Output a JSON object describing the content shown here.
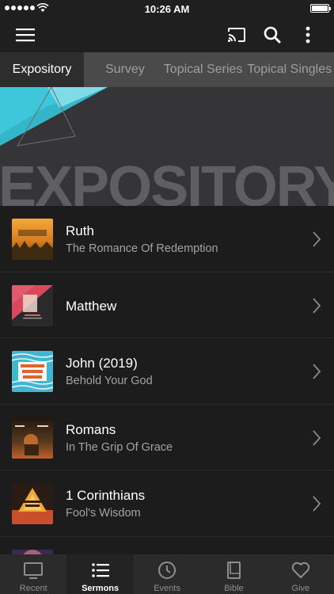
{
  "status_bar": {
    "time": "10:26 AM"
  },
  "app_bar": {
    "icons": [
      "hamburger-menu-icon",
      "cast-icon",
      "search-icon",
      "more-vertical-icon"
    ]
  },
  "tabs": [
    {
      "label": "Expository",
      "active": true
    },
    {
      "label": "Survey",
      "active": false
    },
    {
      "label": "Topical Series",
      "active": false
    },
    {
      "label": "Topical Singles",
      "active": false
    }
  ],
  "banner": {
    "title": "EXPOSITORY",
    "accent_color": "#3cc6d8"
  },
  "sermons": [
    {
      "title": "Ruth",
      "subtitle": "The Romance Of Redemption"
    },
    {
      "title": "Matthew",
      "subtitle": ""
    },
    {
      "title": "John (2019)",
      "subtitle": "Behold Your God"
    },
    {
      "title": "Romans",
      "subtitle": "In The Grip Of Grace"
    },
    {
      "title": "1 Corinthians",
      "subtitle": "Fool's Wisdom"
    }
  ],
  "bottom_nav": [
    {
      "label": "Recent",
      "icon": "tv-icon",
      "active": false
    },
    {
      "label": "Sermons",
      "icon": "list-icon",
      "active": true
    },
    {
      "label": "Events",
      "icon": "clock-icon",
      "active": false
    },
    {
      "label": "Bible",
      "icon": "book-icon",
      "active": false
    },
    {
      "label": "Give",
      "icon": "heart-icon",
      "active": false
    }
  ]
}
